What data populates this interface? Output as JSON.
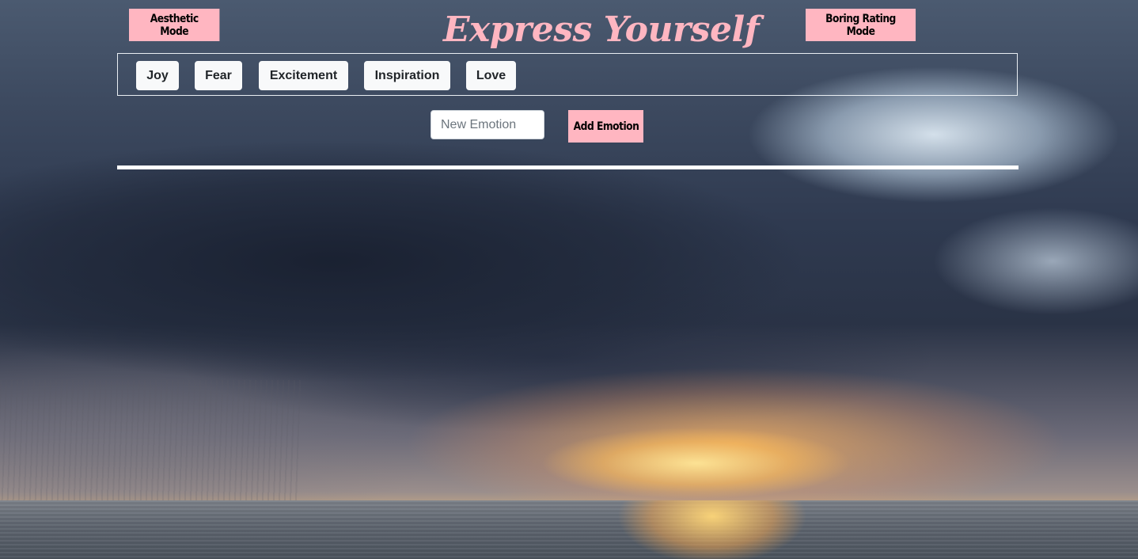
{
  "header": {
    "aesthetic_mode_label": "Aesthetic Mode",
    "title": "Express Yourself",
    "boring_mode_label": "Boring Rating Mode"
  },
  "emotions": [
    {
      "label": "Joy"
    },
    {
      "label": "Fear"
    },
    {
      "label": "Excitement"
    },
    {
      "label": "Inspiration"
    },
    {
      "label": "Love"
    }
  ],
  "add_form": {
    "input_value": "",
    "input_placeholder": "New Emotion",
    "add_label": "Add Emotion"
  },
  "colors": {
    "accent_pink": "#ffb6c1",
    "emotion_button_bg": "#f8f9fa",
    "divider": "#ffffff"
  },
  "background": {
    "scene": "stormy clouds over ocean at sunset"
  }
}
